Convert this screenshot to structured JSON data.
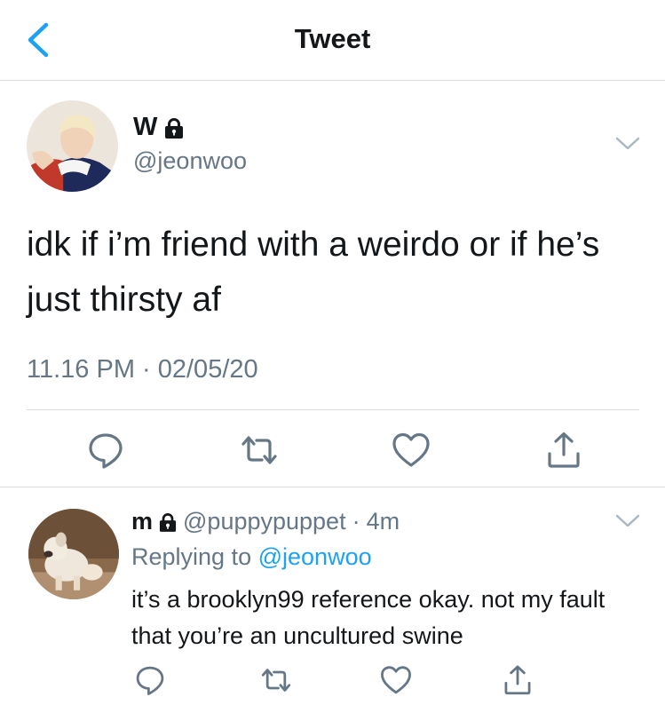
{
  "header": {
    "title": "Tweet"
  },
  "tweet": {
    "display_name": "W",
    "handle": "@jeonwoo",
    "text": "idk if i’m friend with a weirdo or if he’s just thirsty af",
    "timestamp": "11.16 PM · 02/05/20",
    "actions": [
      "reply-icon",
      "retweet-icon",
      "like-icon",
      "share-icon"
    ]
  },
  "reply": {
    "display_name": "m",
    "handle": "@puppypuppet",
    "separator": "·",
    "time": "4m",
    "replying_prefix": "Replying to",
    "replying_handle": "@jeonwoo",
    "text": "it’s a brooklyn99 reference okay. not my fault that you’re an uncultured swine",
    "actions": [
      "reply-icon",
      "retweet-icon",
      "like-icon",
      "share-icon"
    ]
  },
  "colors": {
    "accent": "#1da1f2",
    "secondary_text": "#657786",
    "icon_gray": "#657786",
    "border": "#d9dde1"
  }
}
